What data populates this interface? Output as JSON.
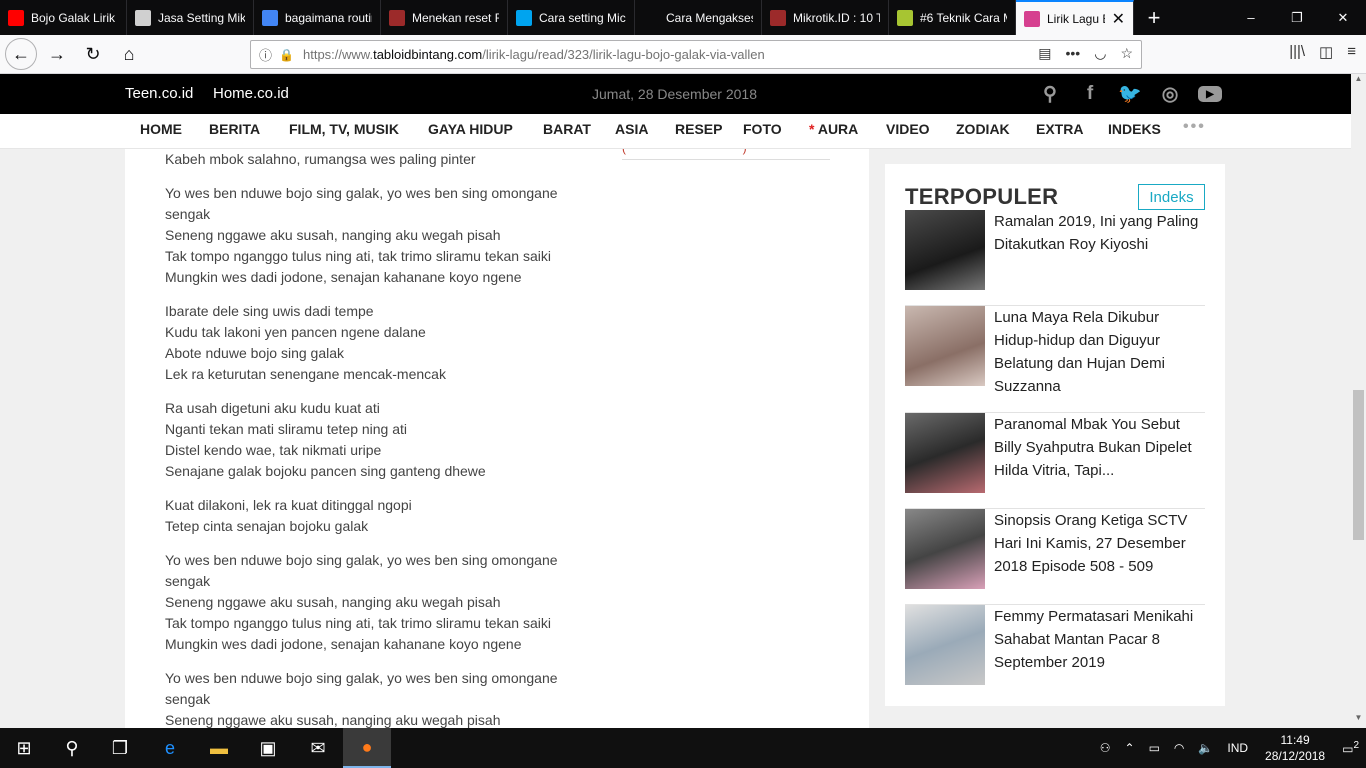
{
  "tabs": [
    {
      "title": "Bojo Galak Lirik",
      "icon": "youtube-icon",
      "color": "#ff0000"
    },
    {
      "title": "Jasa Setting Mikrotik",
      "icon": "page-icon",
      "color": "#d0d0d0"
    },
    {
      "title": "bagaimana routing",
      "icon": "google-icon",
      "color": "#4285f4"
    },
    {
      "title": "Menekan reset R",
      "icon": "mikrotik-icon",
      "color": "#9c2a2a"
    },
    {
      "title": "Cara setting Mic",
      "icon": "windows-icon",
      "color": "#00a4ef"
    },
    {
      "title": "Cara Mengakses Mik",
      "icon": "blank-icon",
      "color": "#0c0c0d"
    },
    {
      "title": "Mikrotik.ID : 10 T",
      "icon": "mikrotik-icon",
      "color": "#9c2a2a"
    },
    {
      "title": "#6 Teknik Cara M",
      "icon": "dot-icon",
      "color": "#a7c532"
    },
    {
      "title": "Lirik Lagu Bojo",
      "icon": "tabloid-icon",
      "color": "#d6408f",
      "active": true
    }
  ],
  "window": {
    "minimize": "–",
    "maximize": "❐",
    "close": "✕",
    "new_tab": "+"
  },
  "address": {
    "url_prefix": "https://www.",
    "url_domain": "tabloidbintang.com",
    "url_path": "/lirik-lagu/read/323/lirik-lagu-bojo-galak-via-vallen"
  },
  "site": {
    "link1": "Teen.co.id",
    "link2": "Home.co.id",
    "date": "Jumat, 28 Desember 2018",
    "social": [
      "search-icon",
      "facebook-icon",
      "twitter-icon",
      "instagram-icon",
      "youtube-icon"
    ]
  },
  "menu": [
    "HOME",
    "BERITA",
    "FILM, TV, MUSIK",
    "GAYA HIDUP",
    "BARAT",
    "ASIA",
    "RESEP",
    "FOTO",
    "AURA",
    "VIDEO",
    "ZODIAK",
    "EXTRA",
    "INDEKS"
  ],
  "menu_more": "•••",
  "lyrics": [
    [
      "Kabeh mbok salahno, rumangsa wes paling pinter"
    ],
    [
      "Yo wes ben nduwe bojo sing galak, yo wes ben sing omongane sengak",
      "Seneng nggawe aku susah, nanging aku wegah pisah",
      "Tak tompo nganggo tulus ning ati, tak trimo sliramu tekan saiki",
      "Mungkin wes dadi jodone, senajan kahanane koyo ngene"
    ],
    [
      "Ibarate dele sing uwis dadi tempe",
      "Kudu tak lakoni yen pancen ngene dalane",
      "Abote nduwe bojo sing galak",
      "Lek ra keturutan senengane mencak-mencak"
    ],
    [
      "Ra usah digetuni aku kudu kuat ati",
      "Nganti tekan mati sliramu tetep ning ati",
      "Distel kendo wae, tak nikmati uripe",
      "Senajane galak bojoku pancen sing ganteng dhewe"
    ],
    [
      "Kuat dilakoni, lek ra kuat ditinggal ngopi",
      "Tetep cinta senajan bojoku galak"
    ],
    [
      "Yo wes ben nduwe bojo sing galak, yo wes ben sing omongane sengak",
      "Seneng nggawe aku susah, nanging aku wegah pisah",
      "Tak tompo nganggo tulus ning ati, tak trimo sliramu tekan saiki",
      "Mungkin wes dadi jodone, senajan kahanane koyo ngene"
    ],
    [
      "Yo wes ben nduwe bojo sing galak, yo wes ben sing omongane sengak",
      "Seneng nggawe aku susah, nanging aku wegah pisah"
    ]
  ],
  "popular": {
    "title": "TERPOPULER",
    "indeks": "Indeks",
    "items": [
      {
        "text": "Ramalan 2019, Ini yang Paling Ditakutkan Roy Kiyoshi"
      },
      {
        "text": "Luna Maya Rela Dikubur Hidup-hidup dan Diguyur Belatung dan Hujan Demi Suzzanna"
      },
      {
        "text": "Paranomal Mbak You Sebut Billy Syahputra Bukan Dipelet Hilda Vitria, Tapi..."
      },
      {
        "text": "Sinopsis Orang Ketiga SCTV Hari Ini Kamis, 27 Desember 2018 Episode 508 - 509"
      },
      {
        "text": "Femmy Permatasari Menikahi Sahabat Mantan Pacar 8 September 2019"
      }
    ]
  },
  "taskbar": {
    "time": "11:49",
    "date": "28/12/2018",
    "lang": "IND",
    "notifications": "2"
  }
}
